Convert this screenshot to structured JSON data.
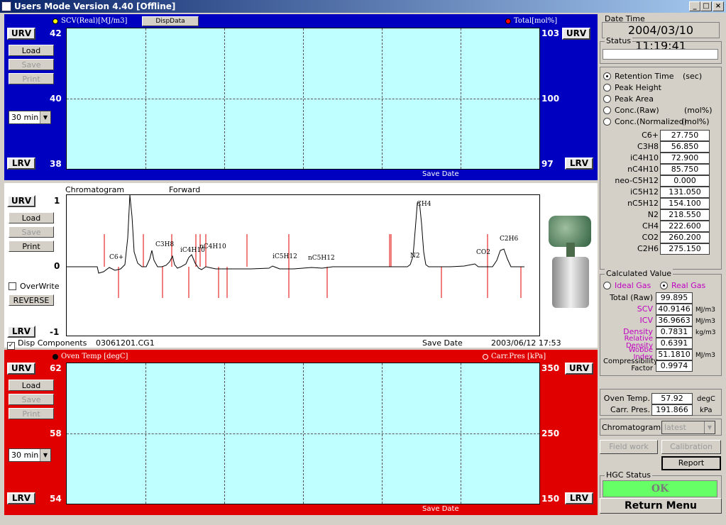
{
  "window": {
    "title": "Users Mode Version 4.40 [Offline]"
  },
  "top_trend": {
    "left_label": "SCV(Real)[MJ/m3]",
    "disp_button": "DispData",
    "right_label": "Total[mol%]",
    "left_axis": [
      "42",
      "40",
      "38"
    ],
    "right_axis": [
      "103",
      "100",
      "97"
    ],
    "urv": "URV",
    "lrv": "LRV",
    "load": "Load",
    "save": "Save",
    "print": "Print",
    "range": "30 min",
    "footer": "Save Date"
  },
  "chromatogram": {
    "title": "Chromatogram",
    "direction": "Forward",
    "y_axis": [
      "1",
      "0",
      "-1"
    ],
    "urv": "URV",
    "lrv": "LRV",
    "load": "Load",
    "save": "Save",
    "print": "Print",
    "overwrite": "OverWrite",
    "reverse": "REVERSE",
    "disp_components": "Disp Components",
    "file": "03061201.CG1",
    "save_date_label": "Save Date",
    "save_date": "2003/06/12 17:53",
    "peaks": [
      "C6+",
      "C3H8",
      "iC4H10",
      "nC4H10",
      "iC5H12",
      "nC5H12",
      "N2",
      "CH4",
      "CO2",
      "C2H6"
    ]
  },
  "bottom_trend": {
    "left_label": "Oven Temp [degC]",
    "right_label": "Carr.Pres [kPa]",
    "left_axis": [
      "62",
      "58",
      "54"
    ],
    "right_axis": [
      "350",
      "250",
      "150"
    ],
    "urv": "URV",
    "lrv": "LRV",
    "load": "Load",
    "save": "Save",
    "print": "Print",
    "range": "30 min",
    "footer": "Save Date"
  },
  "datetime": {
    "label": "Date Time",
    "value": "2004/03/10  11:19:41"
  },
  "status": {
    "label": "Status",
    "value": ""
  },
  "display_mode": {
    "options": [
      {
        "label": "Retention Time",
        "unit": "(sec)"
      },
      {
        "label": "Peak Height",
        "unit": ""
      },
      {
        "label": "Peak Area",
        "unit": ""
      },
      {
        "label": "Conc.(Raw)",
        "unit": "(mol%)"
      },
      {
        "label": "Conc.(Normalized)",
        "unit": "(mol%)"
      }
    ],
    "selected": 0
  },
  "components": [
    {
      "name": "C6+",
      "value": "27.750"
    },
    {
      "name": "C3H8",
      "value": "56.850"
    },
    {
      "name": "iC4H10",
      "value": "72.900"
    },
    {
      "name": "nC4H10",
      "value": "85.750"
    },
    {
      "name": "neo-C5H12",
      "value": "0.000"
    },
    {
      "name": "iC5H12",
      "value": "131.050"
    },
    {
      "name": "nC5H12",
      "value": "154.100"
    },
    {
      "name": "N2",
      "value": "218.550"
    },
    {
      "name": "CH4",
      "value": "222.600"
    },
    {
      "name": "CO2",
      "value": "260.200"
    },
    {
      "name": "C2H6",
      "value": "275.150"
    }
  ],
  "calculated": {
    "label": "Calculated Value",
    "ideal": "Ideal Gas",
    "real": "Real Gas",
    "total_label": "Total (Raw)",
    "total": "99.895",
    "scv_label": "SCV",
    "scv": "40.9146",
    "scv_unit": "MJ/m3",
    "icv_label": "ICV",
    "icv": "36.9663",
    "icv_unit": "MJ/m3",
    "density_label": "Density",
    "density": "0.7831",
    "density_unit": "kg/m3",
    "rel_label": "Relative Density",
    "rel": "0.6391",
    "wobbe_label": "Wobbe Index",
    "wobbe": "51.1810",
    "wobbe_unit": "MJ/m3",
    "comp_label": "Compressibility Factor",
    "comp": "0.9974"
  },
  "oven": {
    "temp_label": "Oven Temp.",
    "temp": "57.92",
    "temp_unit": "degC",
    "pres_label": "Carr. Pres.",
    "pres": "191.866",
    "pres_unit": "kPa"
  },
  "chrom_select": {
    "label": "Chromatogram",
    "value": "latest"
  },
  "buttons": {
    "field_work": "Field work",
    "calibration": "Calibration",
    "report": "Report",
    "return_menu": "Return Menu"
  },
  "hgc": {
    "label": "HGC Status",
    "value": "OK"
  },
  "colors": {
    "blue_panel": "#0000c0",
    "red_panel": "#e00000",
    "plot_bg": "#c0ffff",
    "ok": "#66ff66"
  }
}
